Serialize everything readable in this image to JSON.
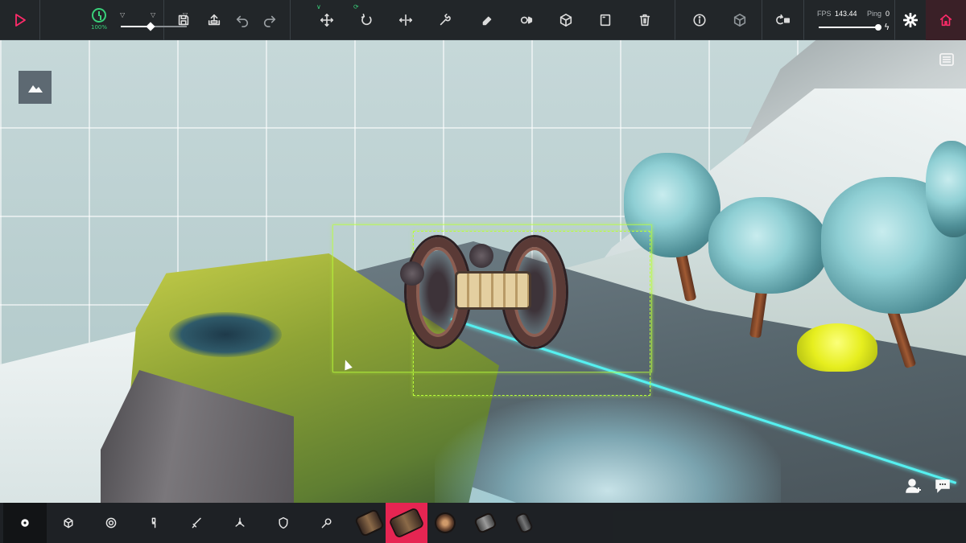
{
  "topbar": {
    "timescale_label": "100%",
    "timescale_level": 1.0,
    "timescale_slider_fraction": 0.45,
    "fps_label": "FPS",
    "fps_value": "143.44",
    "ping_label": "Ping",
    "ping_value": "0",
    "network_slider_fraction": 0.95,
    "accent_color": "#ff2b6a",
    "active_color": "#39d07a",
    "tools": [
      "translate-tool",
      "rotate-tool",
      "flip-tool",
      "modify-tool",
      "erase-tool",
      "center-of-mass-tool",
      "show-block-info-tool",
      "toggle-texture-tool",
      "delete-tool"
    ]
  },
  "bottombar": {
    "categories": [
      "basic",
      "blocks",
      "locomotion",
      "mechanical",
      "weaponry",
      "flight",
      "armour",
      "utility"
    ],
    "active_category": "basic",
    "blocks": [
      "wooden-block",
      "log-block",
      "wheel-block",
      "small-wheel-block",
      "brace-block"
    ],
    "selected_block": "log-block",
    "selected_color": "#e62552"
  }
}
